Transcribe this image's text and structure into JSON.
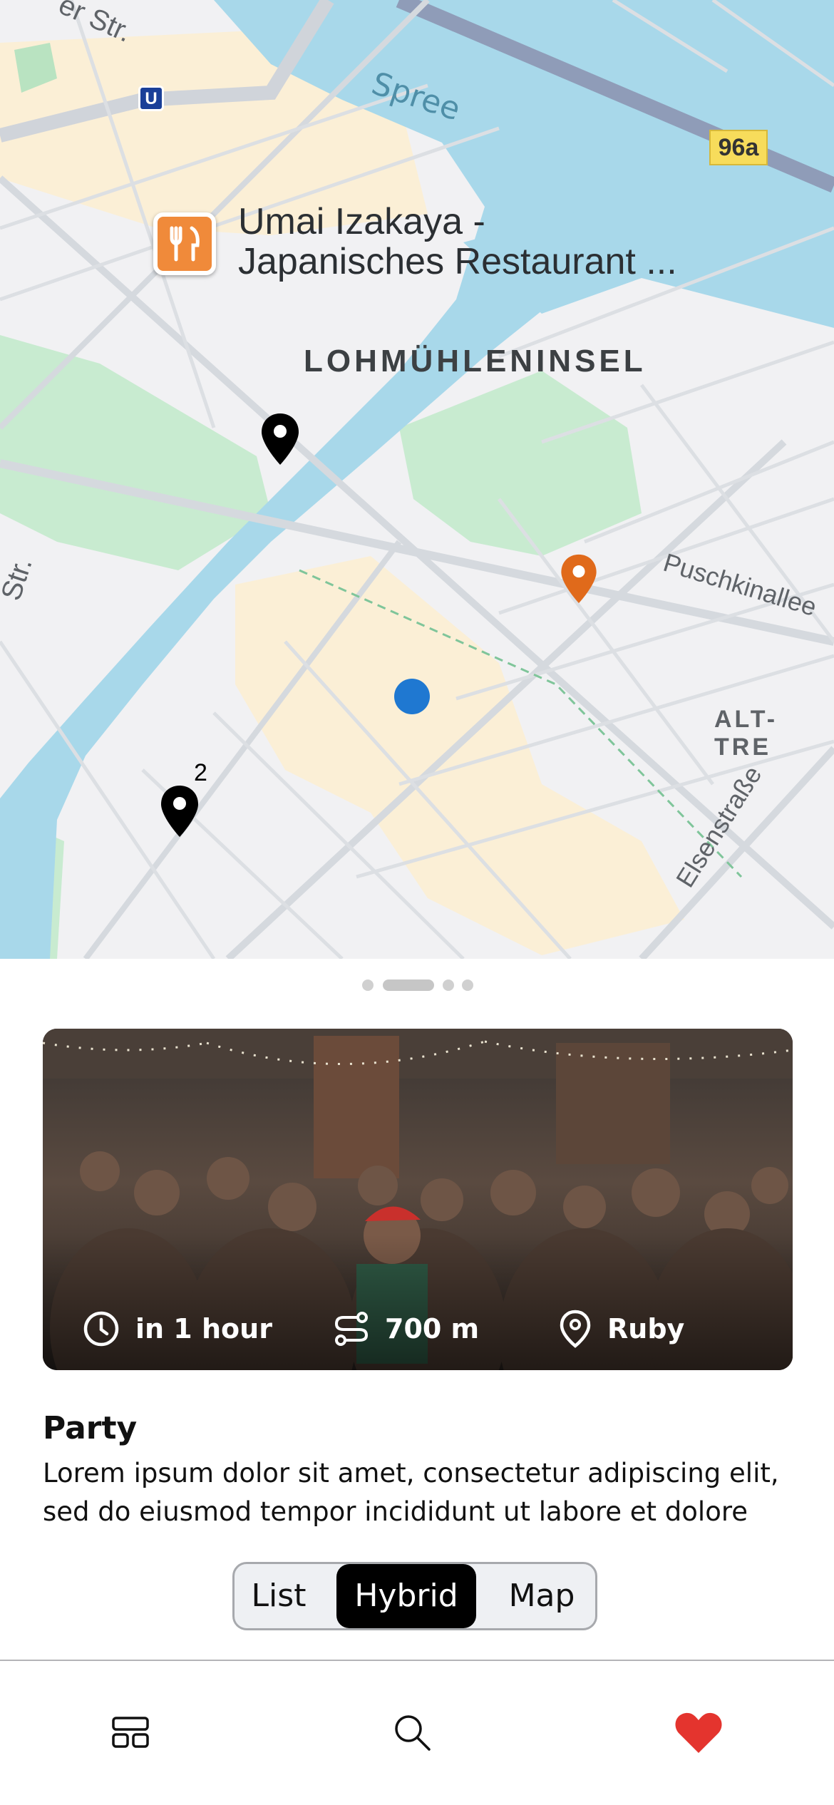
{
  "map": {
    "poi_name": "Umai Izakaya -\nJapanisches Restaurant ...",
    "district": "LOHMÜHLENINSEL",
    "river": "Spree",
    "street_puschkin": "Puschkinallee",
    "street_eisen": "Elsenstraße",
    "street_str_top": "er Str.",
    "street_str_left": "Str.",
    "area_alt": "ALT-TRE",
    "route_badge": "96a",
    "ubahn_label": "U",
    "cluster_count": "2",
    "colors": {
      "water": "#a8d8ea",
      "park": "#c8ebd0",
      "urban": "#fbefd6",
      "land": "#f1f1f3",
      "road": "#d5d9de",
      "pin_black": "#000000",
      "pin_orange": "#e06a1b",
      "user_dot": "#1f78d1"
    }
  },
  "pager": {
    "page_count": 4,
    "active_index": 1
  },
  "event": {
    "time": "in 1 hour",
    "distance": "700 m",
    "location": "Ruby",
    "title": "Party",
    "description": "Lorem ipsum dolor sit amet, consectetur adipiscing elit, sed do eiusmod tempor incididunt ut labore et dolore"
  },
  "view_toggle": {
    "options": [
      "List",
      "Hybrid",
      "Map"
    ],
    "selected": "Hybrid"
  },
  "tabbar": {
    "items": [
      {
        "icon": "layout-grid-icon",
        "active": false
      },
      {
        "icon": "search-icon",
        "active": false
      },
      {
        "icon": "heart-icon",
        "active": true,
        "color": "#e4342e"
      }
    ]
  }
}
